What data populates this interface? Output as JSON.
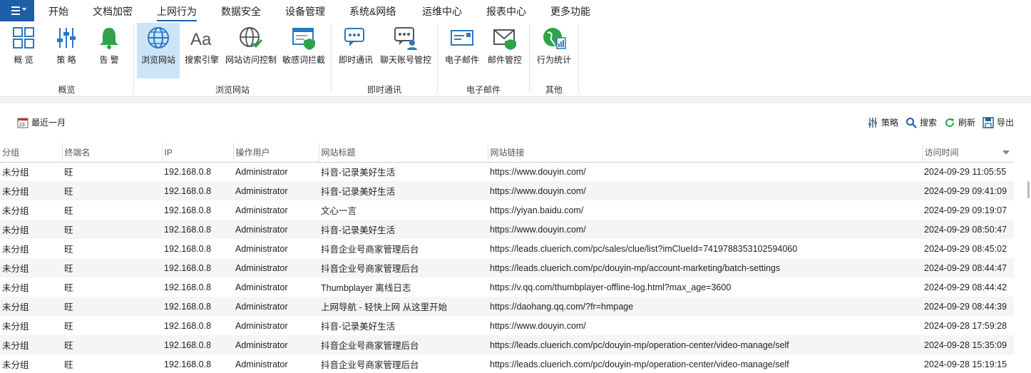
{
  "menu": {
    "items": [
      "开始",
      "文档加密",
      "上网行为",
      "数据安全",
      "设备管理",
      "系统&网络",
      "运维中心",
      "报表中心",
      "更多功能"
    ],
    "active": "上网行为"
  },
  "ribbon": {
    "buttons": [
      {
        "label": "概 览",
        "icon": "overview-grid-icon"
      },
      {
        "label": "策 略",
        "icon": "policy-sliders-icon"
      },
      {
        "label": "告 警",
        "icon": "alarm-bell-icon"
      },
      {
        "label": "浏览网站",
        "icon": "globe-icon"
      },
      {
        "label": "搜索引擎",
        "icon": "search-engine-aa-icon"
      },
      {
        "label": "网站访问控制",
        "icon": "globe-control-icon"
      },
      {
        "label": "敏感词拦截",
        "icon": "sensitive-word-block-icon"
      },
      {
        "label": "即时通讯",
        "icon": "chat-icon"
      },
      {
        "label": "聊天账号管控",
        "icon": "chat-account-icon"
      },
      {
        "label": "电子邮件",
        "icon": "email-icon"
      },
      {
        "label": "邮件管控",
        "icon": "email-control-icon"
      },
      {
        "label": "行为统计",
        "icon": "behavior-stats-icon"
      }
    ],
    "groups": [
      "概览",
      "浏览网站",
      "即时通讯",
      "电子邮件",
      "其他"
    ]
  },
  "toolbar": {
    "date_range": "最近一月",
    "policy": "策略",
    "search": "搜索",
    "refresh": "刷新",
    "export": "导出"
  },
  "table": {
    "columns": [
      "分组",
      "终端名",
      "IP",
      "操作用户",
      "网站标题",
      "网站链接",
      "访问时间"
    ],
    "rows": [
      [
        "未分组",
        "旺",
        "192.168.0.8",
        "Administrator",
        "抖音-记录美好生活",
        "https://www.douyin.com/",
        "2024-09-29 11:05:55"
      ],
      [
        "未分组",
        "旺",
        "192.168.0.8",
        "Administrator",
        "抖音-记录美好生活",
        "https://www.douyin.com/",
        "2024-09-29 09:41:09"
      ],
      [
        "未分组",
        "旺",
        "192.168.0.8",
        "Administrator",
        "文心一言",
        "https://yiyan.baidu.com/",
        "2024-09-29 09:19:07"
      ],
      [
        "未分组",
        "旺",
        "192.168.0.8",
        "Administrator",
        "抖音-记录美好生活",
        "https://www.douyin.com/",
        "2024-09-29 08:50:47"
      ],
      [
        "未分组",
        "旺",
        "192.168.0.8",
        "Administrator",
        "抖音企业号商家管理后台",
        "https://leads.cluerich.com/pc/sales/clue/list?imClueId=7419788353102594060",
        "2024-09-29 08:45:02"
      ],
      [
        "未分组",
        "旺",
        "192.168.0.8",
        "Administrator",
        "抖音企业号商家管理后台",
        "https://leads.cluerich.com/pc/douyin-mp/account-marketing/batch-settings",
        "2024-09-29 08:44:47"
      ],
      [
        "未分组",
        "旺",
        "192.168.0.8",
        "Administrator",
        "Thumbplayer 离线日志",
        "https://v.qq.com/thumbplayer-offline-log.html?max_age=3600",
        "2024-09-29 08:44:42"
      ],
      [
        "未分组",
        "旺",
        "192.168.0.8",
        "Administrator",
        "上网导航 - 轻快上网 从这里开始",
        "https://daohang.qq.com/?fr=hmpage",
        "2024-09-29 08:44:39"
      ],
      [
        "未分组",
        "旺",
        "192.168.0.8",
        "Administrator",
        "抖音-记录美好生活",
        "https://www.douyin.com/",
        "2024-09-28 17:59:28"
      ],
      [
        "未分组",
        "旺",
        "192.168.0.8",
        "Administrator",
        "抖音企业号商家管理后台",
        "https://leads.cluerich.com/pc/douyin-mp/operation-center/video-manage/self",
        "2024-09-28 15:35:09"
      ],
      [
        "未分组",
        "旺",
        "192.168.0.8",
        "Administrator",
        "抖音企业号商家管理后台",
        "https://leads.cluerich.com/pc/douyin-mp/operation-center/video-manage/self",
        "2024-09-28 15:19:15"
      ]
    ]
  },
  "colors": {
    "accent": "#1e5fa8",
    "active_ribbon": "#cce4f7",
    "icon_blue": "#2b79c2",
    "icon_green": "#2ea34a"
  }
}
